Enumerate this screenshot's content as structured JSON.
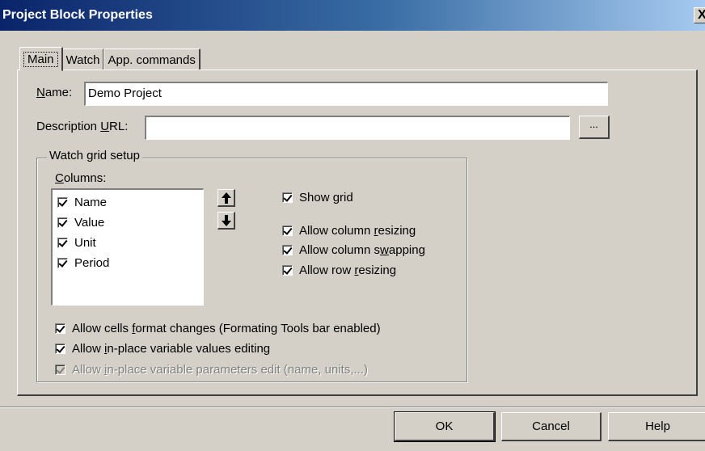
{
  "window": {
    "title": "Project Block Properties",
    "close_glyph": "X"
  },
  "tabs": [
    {
      "label": "Main",
      "active": true
    },
    {
      "label": "Watch",
      "active": false
    },
    {
      "label": "App. commands",
      "active": false
    }
  ],
  "main": {
    "name_label_u": "N",
    "name_label_rest": "ame:",
    "name_value": "Demo Project",
    "url_label_pre": "Description ",
    "url_label_u": "U",
    "url_label_rest": "RL:",
    "url_value": "",
    "browse_label": "..."
  },
  "watch_grid": {
    "title": "Watch grid setup",
    "columns_label_u": "C",
    "columns_label_rest": "olumns:",
    "columns": [
      {
        "label": "Name",
        "checked": true
      },
      {
        "label": "Value",
        "checked": true
      },
      {
        "label": "Unit",
        "checked": true
      },
      {
        "label": "Period",
        "checked": true
      }
    ],
    "move_up_icon": "arrow-up-icon",
    "move_down_icon": "arrow-down-icon",
    "show_grid": {
      "pre": "Show ",
      "u": "g",
      "post": "rid",
      "checked": true
    },
    "allow_column_resizing": {
      "pre": "Allow column ",
      "u": "r",
      "post": "esizing",
      "checked": true
    },
    "allow_column_swapping": {
      "pre": "Allow column s",
      "u": "w",
      "post": "apping",
      "checked": true
    },
    "allow_row_resizing": {
      "pre": "Allow row ",
      "u": "r",
      "post": "esizing",
      "checked": true
    },
    "allow_cells_format": {
      "pre": "Allow cells ",
      "u": "f",
      "post": "ormat changes (Formating Tools bar enabled)",
      "checked": true
    },
    "allow_inplace_values": {
      "pre": "Allow ",
      "u": "i",
      "post": "n-place variable values editing",
      "checked": true
    },
    "allow_inplace_params": {
      "pre": "Allow ",
      "u": "i",
      "post": "n-place variable parameters edit (name, units,...)",
      "checked": true,
      "disabled": true
    }
  },
  "buttons": {
    "ok": "OK",
    "cancel": "Cancel",
    "help": "Help"
  }
}
